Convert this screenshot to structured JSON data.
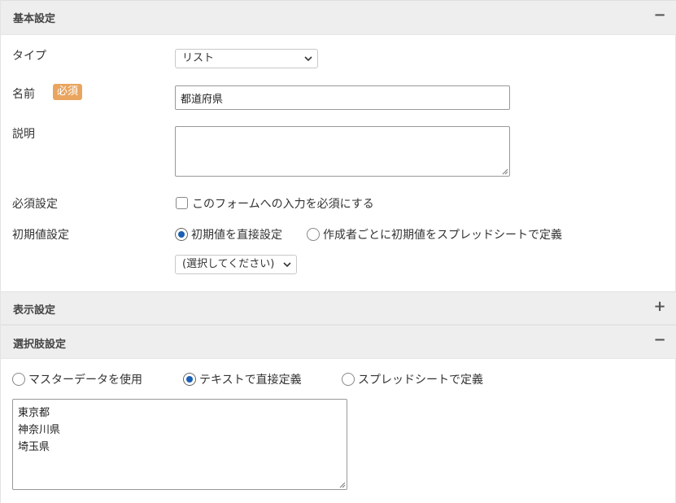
{
  "sections": {
    "basic": {
      "title": "基本設定",
      "toggle": "−"
    },
    "display": {
      "title": "表示設定",
      "toggle": "+"
    },
    "choices": {
      "title": "選択肢設定",
      "toggle": "−"
    }
  },
  "basic": {
    "type_label": "タイプ",
    "type_value": "リスト",
    "name_label": "名前",
    "required_badge": "必須",
    "name_value": "都道府県",
    "description_label": "説明",
    "description_value": "",
    "required_setting_label": "必須設定",
    "required_checkbox_label": "このフォームへの入力を必須にする",
    "required_checked": false,
    "initial_label": "初期値設定",
    "initial_options": [
      {
        "label": "初期値を直接設定",
        "checked": true
      },
      {
        "label": "作成者ごとに初期値をスプレッドシートで定義",
        "checked": false
      }
    ],
    "initial_select_value": "(選択してください)"
  },
  "choices": {
    "source_options": [
      {
        "label": "マスターデータを使用",
        "checked": false
      },
      {
        "label": "テキストで直接定義",
        "checked": true
      },
      {
        "label": "スプレッドシートで定義",
        "checked": false
      }
    ],
    "items": [
      "東京都",
      "神奈川県",
      "埼玉県"
    ]
  },
  "colors": {
    "accent": "#1a5fb4",
    "badge": "#e9a560",
    "header_bg": "#eeeeee"
  },
  "icons": {
    "collapse": "minus-icon",
    "expand": "plus-icon",
    "dropdown": "chevron-down-icon"
  }
}
